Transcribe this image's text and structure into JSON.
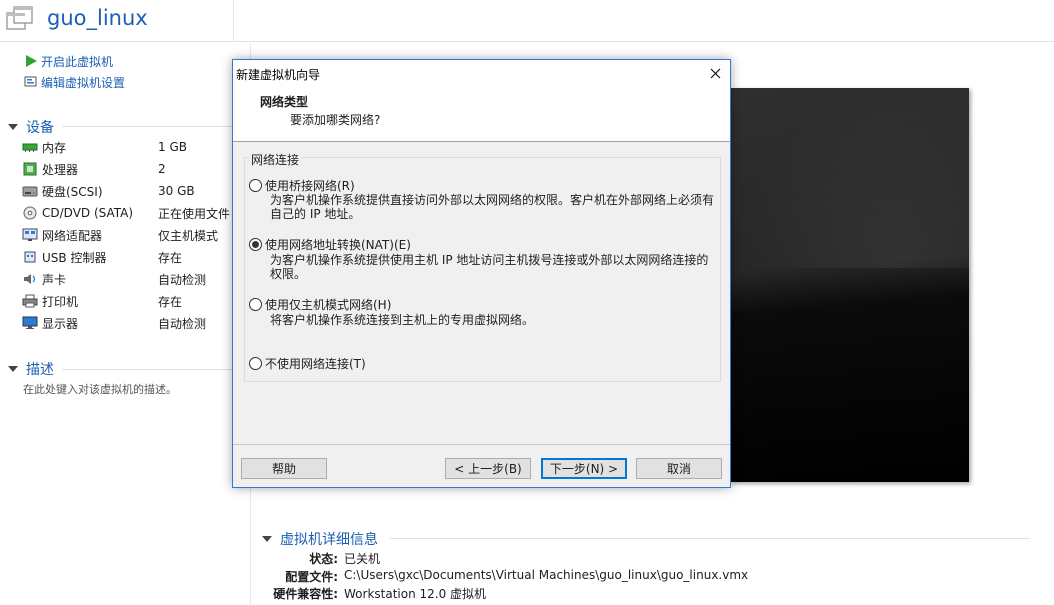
{
  "vm": {
    "title": "guo_linux",
    "actions": {
      "power_on": "开启此虚拟机",
      "edit_settings": "编辑虚拟机设置"
    },
    "devices_heading": "设备",
    "devices": [
      {
        "icon": "memory-icon",
        "name": "内存",
        "value": "1 GB"
      },
      {
        "icon": "processor-icon",
        "name": "处理器",
        "value": "2"
      },
      {
        "icon": "hard-disk-icon",
        "name": "硬盘(SCSI)",
        "value": "30 GB"
      },
      {
        "icon": "cd-dvd-icon",
        "name": "CD/DVD (SATA)",
        "value": "正在使用文件 E:"
      },
      {
        "icon": "network-adapter-icon",
        "name": "网络适配器",
        "value": "仅主机模式"
      },
      {
        "icon": "usb-icon",
        "name": "USB 控制器",
        "value": "存在"
      },
      {
        "icon": "sound-card-icon",
        "name": "声卡",
        "value": "自动检测"
      },
      {
        "icon": "printer-icon",
        "name": "打印机",
        "value": "存在"
      },
      {
        "icon": "display-icon",
        "name": "显示器",
        "value": "自动检测"
      }
    ],
    "description_heading": "描述",
    "description_hint": "在此处键入对该虚拟机的描述。",
    "details_heading": "虚拟机详细信息",
    "details": {
      "status_label": "状态:",
      "status_value": "已关机",
      "config_label": "配置文件:",
      "config_value": "C:\\Users\\gxc\\Documents\\Virtual Machines\\guo_linux\\guo_linux.vmx",
      "compat_label": "硬件兼容性:",
      "compat_value": "Workstation 12.0 虚拟机"
    }
  },
  "dialog": {
    "title": "新建虚拟机向导",
    "heading": "网络类型",
    "subheading": "要添加哪类网络?",
    "group_label": "网络连接",
    "options": [
      {
        "label": "使用桥接网络(R)",
        "desc": "为客户机操作系统提供直接访问外部以太网网络的权限。客户机在外部网络上必须有自己的 IP 地址。",
        "selected": false
      },
      {
        "label": "使用网络地址转换(NAT)(E)",
        "desc": "为客户机操作系统提供使用主机 IP 地址访问主机拨号连接或外部以太网网络连接的权限。",
        "selected": true
      },
      {
        "label": "使用仅主机模式网络(H)",
        "desc": "将客户机操作系统连接到主机上的专用虚拟网络。",
        "selected": false
      },
      {
        "label": "不使用网络连接(T)",
        "desc": "",
        "selected": false
      }
    ],
    "buttons": {
      "help": "帮助",
      "back": "< 上一步(B)",
      "next": "下一步(N) >",
      "cancel": "取消"
    }
  }
}
